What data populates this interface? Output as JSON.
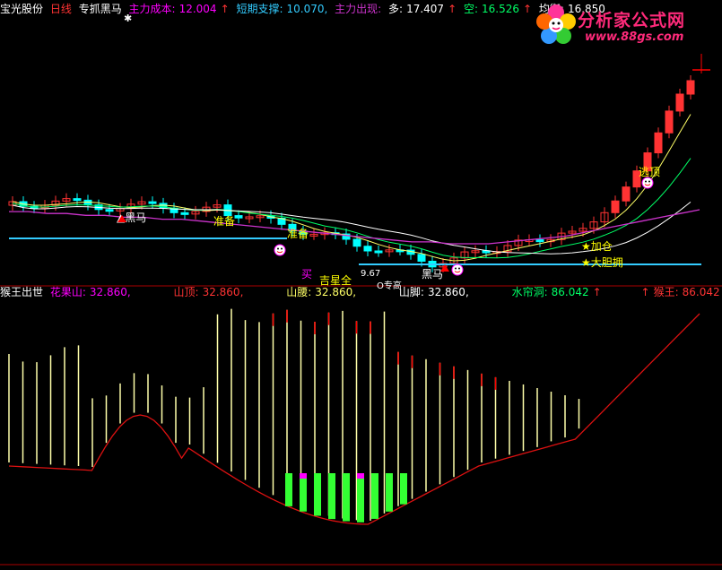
{
  "colors": {
    "bg": "#000000",
    "up_candle": "#ff3333",
    "down_candle": "#00ffff",
    "white": "#ffffff",
    "yellow": "#ffff00",
    "magenta": "#ff00ff",
    "cyan": "#00ffff",
    "green": "#00ff00",
    "red": "#ff0000",
    "ma_white": "#ffffff",
    "ma_yellow": "#ffff66",
    "ma_green": "#00ff66",
    "ma_purple": "#cc33cc",
    "support": "#33ccff",
    "curve_red": "#dd1111",
    "bar_yellow": "#ffffaa",
    "bar_green": "#33ff33"
  },
  "top_header": {
    "stock": "宝光股份",
    "period": "日线",
    "indicator": "专抓黑马",
    "cost_label": "主力成本:",
    "cost_value": "12.004",
    "support_label": "短期支撑:",
    "support_value": "10.070,",
    "out_label": "主力出现:",
    "long_label": "多:",
    "long_value": "17.407",
    "short_label": "空:",
    "short_value": "16.526",
    "balance_label": "均衡:",
    "balance_value": "16.850",
    "up_arrow": "↑"
  },
  "bottom_header": {
    "name": "猴王出世",
    "l1": "花果山:",
    "v1": "32.860,",
    "l2": "山顶:",
    "v2": "32.860,",
    "l3": "山腰:",
    "v3": "32.860,",
    "l4": "山脚:",
    "v4": "32.860,",
    "l5": "水帘洞:",
    "v5": "86.042",
    "l6": "猴王:",
    "v6": "86.042",
    "up_arrow": "↑"
  },
  "watermark": {
    "title": "分析家公式网",
    "url": "www.88gs.com"
  },
  "annotations": {
    "heima": "▲黑马",
    "zhunbei": "准备",
    "mai": "买",
    "jiuxing": "吉星全",
    "price_low": "9.67",
    "heima2": "黑马",
    "jiacang": "★加仓",
    "dadanmai": "★大胆拥",
    "taoding": "逃顶",
    "qi": "O专高"
  },
  "chart_data": [
    {
      "type": "candlestick",
      "title": "专抓黑马",
      "series": [
        {
          "name": "主力成本",
          "values": [
            11.9,
            11.9,
            11.8,
            11.8,
            11.7,
            11.7,
            11.6,
            11.6,
            11.5,
            11.5,
            11.4,
            11.3,
            11.2,
            11.1,
            11.0,
            10.9,
            10.8,
            10.7,
            10.6,
            10.5,
            10.4,
            10.3,
            10.3,
            10.2,
            10.2,
            10.2,
            10.3,
            10.4,
            10.5,
            10.6,
            10.8,
            11.0,
            11.2,
            11.4,
            11.6,
            11.8,
            12.0
          ]
        },
        {
          "name": "短期支撑",
          "values": [
            10.07
          ]
        }
      ]
    },
    {
      "type": "bar",
      "title": "猴王出世",
      "series": [
        {
          "name": "花果山",
          "values": [
            32.86
          ]
        },
        {
          "name": "山顶",
          "values": [
            32.86
          ]
        },
        {
          "name": "山腰",
          "values": [
            32.86
          ]
        },
        {
          "name": "山脚",
          "values": [
            32.86
          ]
        },
        {
          "name": "水帘洞",
          "values": [
            86.042
          ]
        },
        {
          "name": "猴王",
          "values": [
            86.042
          ]
        }
      ]
    }
  ]
}
